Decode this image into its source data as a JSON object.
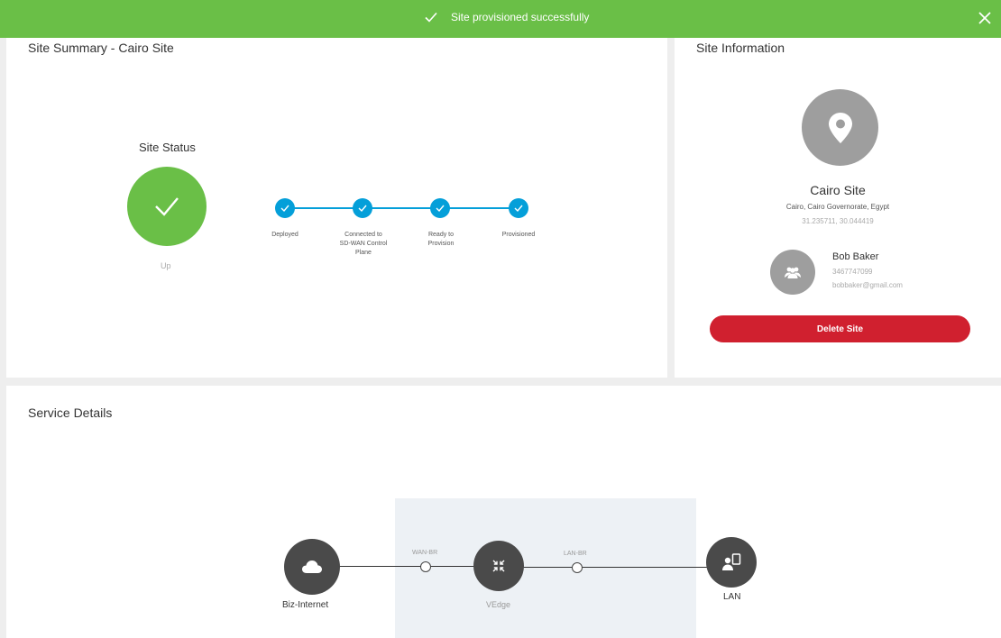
{
  "banner": {
    "message": "Site provisioned successfully",
    "color": "#6abf47",
    "check_icon": "checkmark-icon",
    "close_icon": "close-icon"
  },
  "summary": {
    "title": "Site Summary - Cairo Site",
    "status_title": "Site Status",
    "status_value": "Up",
    "status_icon": "checkmark-icon",
    "steps": [
      {
        "label_lines": [
          "Deployed"
        ]
      },
      {
        "label_lines": [
          "Connected to",
          "SD-WAN Control",
          "Plane"
        ]
      },
      {
        "label_lines": [
          "Ready to",
          "Provision"
        ]
      },
      {
        "label_lines": [
          "Provisioned"
        ]
      }
    ],
    "step_color": "#049fd9"
  },
  "info": {
    "title": "Site Information",
    "pin_icon": "location-pin-icon",
    "site_name": "Cairo Site",
    "address": "Cairo, Cairo Governorate, Egypt",
    "coordinates": "31.235711, 30.044419",
    "contact": {
      "icon": "users-icon",
      "name": "Bob Baker",
      "phone": "3467747099",
      "email": "bobbaker@gmail.com"
    },
    "delete_label": "Delete Site",
    "delete_color": "#d0202f"
  },
  "service": {
    "title": "Service Details",
    "internet_label": "Biz-Internet",
    "internet_icon": "cloud-icon",
    "wan_port": "WAN-BR",
    "edge_label": "VEdge",
    "edge_icon": "compress-arrows-icon",
    "lan_port": "LAN-BR",
    "lan_label": "LAN",
    "lan_icon": "user-device-icon"
  }
}
